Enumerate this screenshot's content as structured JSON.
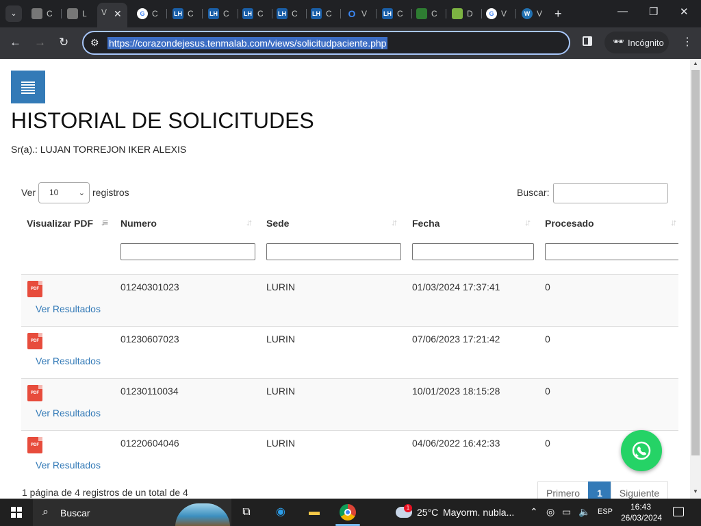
{
  "browser": {
    "tabs": [
      {
        "favicon": "page-icon",
        "title": "C"
      },
      {
        "favicon": "page-icon",
        "title": "L"
      },
      {
        "favicon": "page-icon",
        "title": "V",
        "active": true
      },
      {
        "favicon": "google-icon",
        "title": "C"
      },
      {
        "favicon": "lh-icon",
        "title": "C"
      },
      {
        "favicon": "lh-icon",
        "title": "C"
      },
      {
        "favicon": "lh-icon",
        "title": "C"
      },
      {
        "favicon": "lh-icon",
        "title": "C"
      },
      {
        "favicon": "lh-icon",
        "title": "C"
      },
      {
        "favicon": "opera-icon",
        "title": "V"
      },
      {
        "favicon": "lh-icon",
        "title": "C"
      },
      {
        "favicon": "plant-icon",
        "title": "C"
      },
      {
        "favicon": "square-icon",
        "title": "D"
      },
      {
        "favicon": "google-icon",
        "title": "V"
      },
      {
        "favicon": "wordpress-icon",
        "title": "V"
      }
    ],
    "url": "https://corazondejesus.tenmalab.com/views/solicitudpaciente.php",
    "incognito_label": "Incógnito"
  },
  "page": {
    "title": "HISTORIAL DE SOLICITUDES",
    "patient": "Sr(a).: LUJAN TORREJON IKER ALEXIS",
    "length_prefix": "Ver",
    "length_value": "10",
    "length_suffix": "registros",
    "search_label": "Buscar:",
    "columns": [
      "Visualizar PDF",
      "Numero",
      "Sede",
      "Fecha",
      "Procesado"
    ],
    "link_label": "Ver Resultados",
    "pdf_label": "PDF",
    "rows": [
      {
        "numero": "01240301023",
        "sede": "LURIN",
        "fecha": "01/03/2024 17:37:41",
        "procesado": "0"
      },
      {
        "numero": "01230607023",
        "sede": "LURIN",
        "fecha": "07/06/2023 17:21:42",
        "procesado": "0"
      },
      {
        "numero": "01230110034",
        "sede": "LURIN",
        "fecha": "10/01/2023 18:15:28",
        "procesado": "0"
      },
      {
        "numero": "01220604046",
        "sede": "LURIN",
        "fecha": "04/06/2022 16:42:33",
        "procesado": "0"
      }
    ],
    "info": "1 página de 4 registros de un total de 4",
    "pagination": {
      "first": "Primero",
      "current": "1",
      "next": "Siguiente"
    }
  },
  "taskbar": {
    "search_placeholder": "Buscar",
    "weather_badge": "1",
    "temperature": "25°C",
    "weather_desc": "Mayorm. nubla...",
    "language": "ESP",
    "time": "16:43",
    "date": "26/03/2024"
  },
  "colors": {
    "primary": "#337ab7",
    "whatsapp": "#25d366",
    "pdf": "#e74c3c"
  }
}
